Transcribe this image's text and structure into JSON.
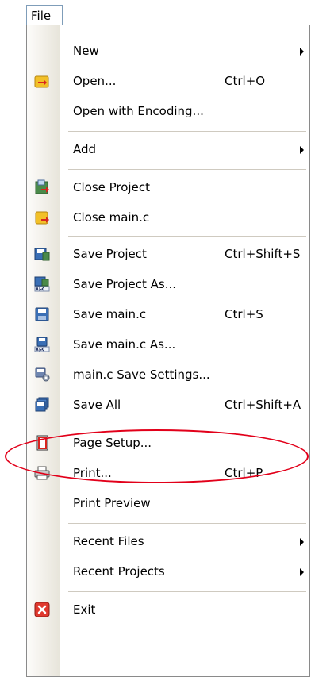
{
  "menubar": {
    "file_label": "File"
  },
  "colors": {
    "highlight": "#e2001a",
    "gutter": "#e7e4da"
  },
  "menu": {
    "items": [
      {
        "label": "New",
        "shortcut": "",
        "icon": "none",
        "submenu": true
      },
      {
        "label": "Open...",
        "shortcut": "Ctrl+O",
        "icon": "open-folder-icon"
      },
      {
        "label": "Open with Encoding...",
        "shortcut": "",
        "icon": "none"
      },
      {
        "label": "Add",
        "shortcut": "",
        "icon": "none",
        "submenu": true
      },
      {
        "label": "Close Project",
        "shortcut": "",
        "icon": "close-project-icon"
      },
      {
        "label": "Close main.c",
        "shortcut": "",
        "icon": "close-file-icon"
      },
      {
        "label": "Save Project",
        "shortcut": "Ctrl+Shift+S",
        "icon": "save-project-icon"
      },
      {
        "label": "Save Project As...",
        "shortcut": "",
        "icon": "save-project-as-icon"
      },
      {
        "label": "Save main.c",
        "shortcut": "Ctrl+S",
        "icon": "floppy-disk-icon"
      },
      {
        "label": "Save main.c As...",
        "shortcut": "",
        "icon": "save-as-icon"
      },
      {
        "label": "main.c Save Settings...",
        "shortcut": "",
        "icon": "save-settings-icon"
      },
      {
        "label": "Save All",
        "shortcut": "Ctrl+Shift+A",
        "icon": "save-all-icon"
      },
      {
        "label": "Page Setup...",
        "shortcut": "",
        "icon": "page-setup-icon"
      },
      {
        "label": "Print...",
        "shortcut": "Ctrl+P",
        "icon": "printer-icon"
      },
      {
        "label": "Print Preview",
        "shortcut": "",
        "icon": "none"
      },
      {
        "label": "Recent Files",
        "shortcut": "",
        "icon": "none",
        "submenu": true
      },
      {
        "label": "Recent Projects",
        "shortcut": "",
        "icon": "none",
        "submenu": true
      },
      {
        "label": "Exit",
        "shortcut": "",
        "icon": "exit-icon"
      }
    ]
  }
}
